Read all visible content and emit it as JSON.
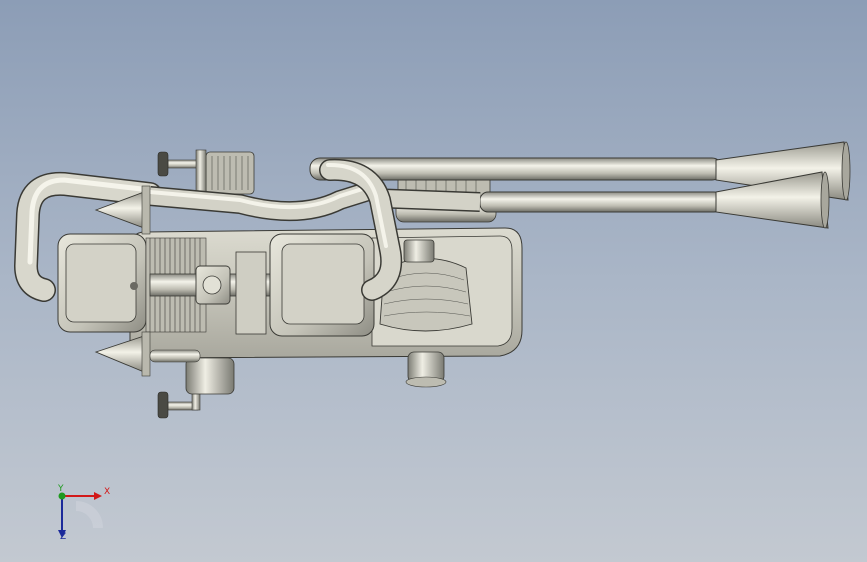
{
  "viewport": {
    "background_top": "#8c9db6",
    "background_bottom": "#c3c9d1"
  },
  "model": {
    "material_color": "#c9c8bd",
    "edge_color": "#3a3a35"
  },
  "triad": {
    "x_label": "X",
    "y_label": "Y",
    "z_label": "Z",
    "x_color": "#d21818",
    "y_color": "#1f9a1f",
    "z_color": "#1b2a9a"
  }
}
